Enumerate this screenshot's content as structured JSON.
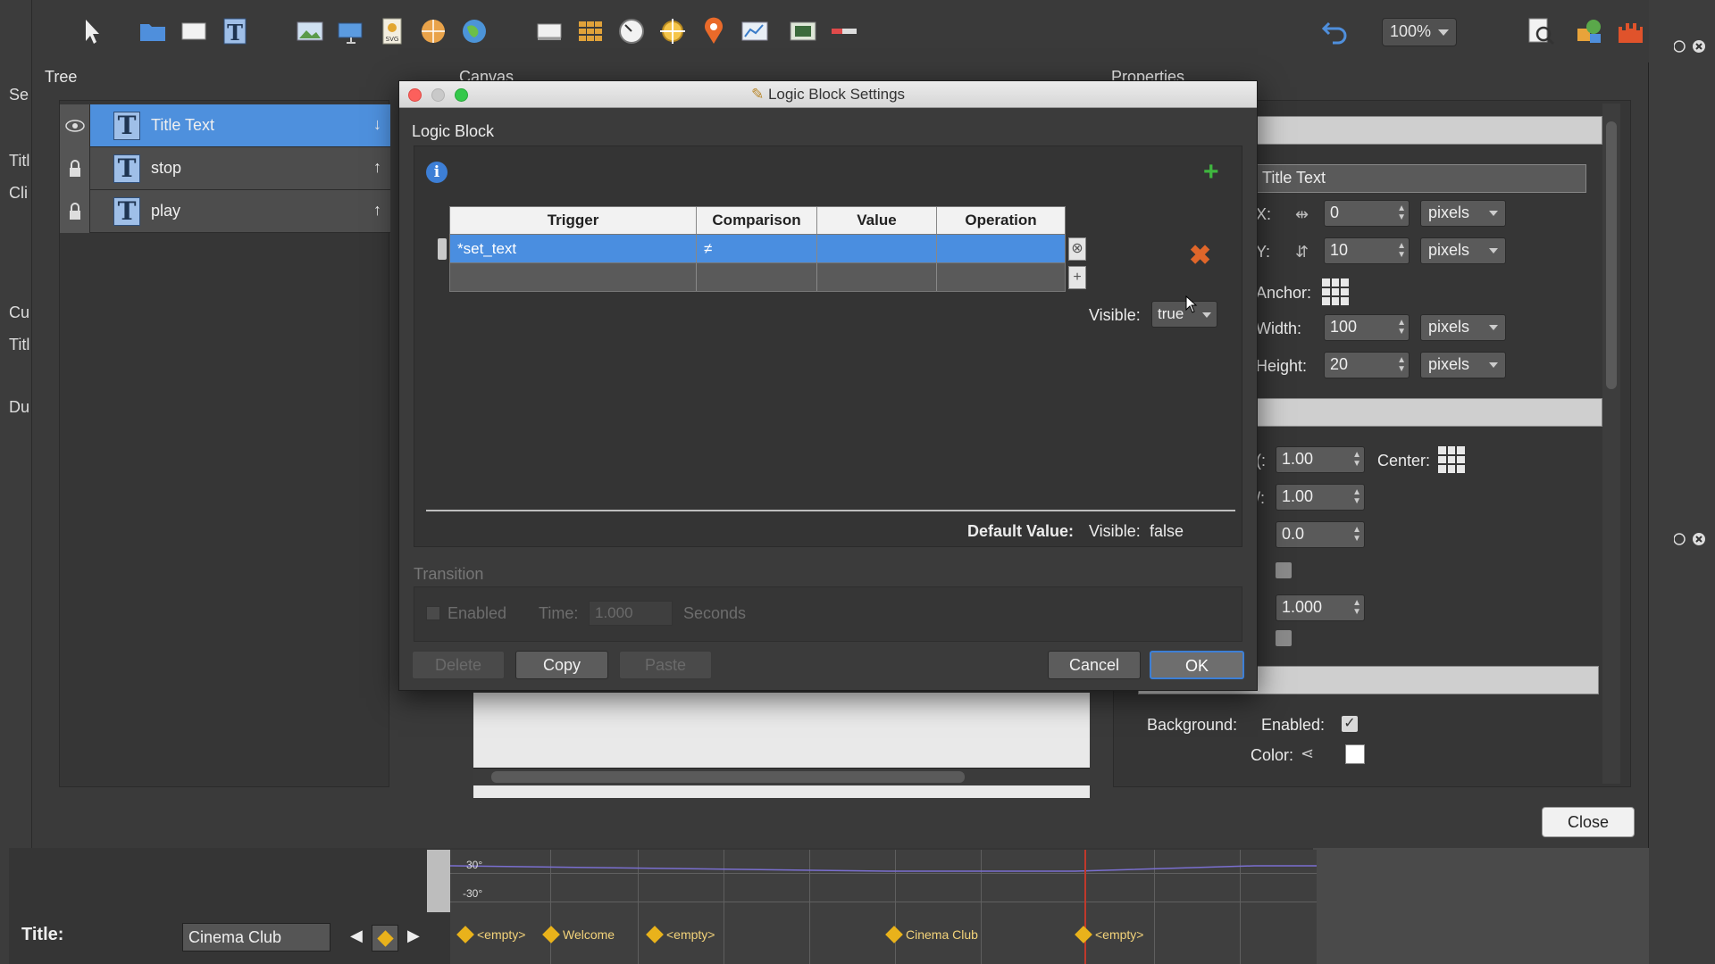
{
  "toolbar": {
    "zoom": "100%",
    "icons": [
      "pointer-icon",
      "folder-icon",
      "rectangle-icon",
      "text-icon",
      "image-icon",
      "slideshow-icon",
      "svg-icon",
      "sphere-icon",
      "globe-icon",
      "screen-icon",
      "grid-icon",
      "gauge-icon",
      "crosshair-icon",
      "map-pin-icon",
      "chart-icon",
      "video-icon",
      "progress-icon",
      "undo-icon",
      "search-icon",
      "shapes-icon",
      "castle-icon"
    ]
  },
  "panels": {
    "tree": "Tree",
    "canvas": "Canvas",
    "properties": "Properties"
  },
  "left_cut_labels": [
    "Se",
    "Titl",
    "Cli",
    "Cu",
    "Titl",
    "Du"
  ],
  "tree": {
    "items": [
      {
        "label": "Title Text",
        "arrow": "↓",
        "lock_icon": "eye-icon",
        "selected": true
      },
      {
        "label": "stop",
        "arrow": "↑",
        "lock_icon": "lock-icon",
        "selected": false
      },
      {
        "label": "play",
        "arrow": "↑",
        "lock_icon": "lock-icon",
        "selected": false
      }
    ]
  },
  "properties": {
    "name_value": "Title Text",
    "x_label": "X:",
    "x_value": "0",
    "x_unit": "pixels",
    "y_label": "Y:",
    "y_value": "10",
    "y_unit": "pixels",
    "anchor_label": "Anchor:",
    "width_label": "Width:",
    "width_value": "100",
    "width_unit": "pixels",
    "height_label": "Height:",
    "height_value": "20",
    "height_unit": "pixels",
    "scale_x_label": "(:",
    "scale_x_value": "1.00",
    "center_label": "Center:",
    "scale_y_label": "/:",
    "scale_y_value": "1.00",
    "rotation_value": "0.0",
    "opacity_value": "1.000",
    "background_label": "Background:",
    "enabled_label": "Enabled:",
    "color_label": "Color:",
    "close_label": "Close"
  },
  "timeline": {
    "title_label": "Title:",
    "title_value": "Cinema Club",
    "deg_top": "30°",
    "deg_bottom": "-30°",
    "keyframes": [
      "<empty>",
      "Welcome",
      "<empty>",
      "Cinema Club",
      "<empty>"
    ]
  },
  "dialog": {
    "title": "Logic Block Settings",
    "section": "Logic Block",
    "columns": [
      "Trigger",
      "Comparison",
      "Value",
      "Operation"
    ],
    "rows": [
      {
        "trigger": "*set_text",
        "comparison": "≠",
        "value": "",
        "operation": ""
      },
      {
        "trigger": "",
        "comparison": "",
        "value": "",
        "operation": ""
      }
    ],
    "visible_label": "Visible:",
    "visible_value": "true",
    "default_value_label": "Default Value:",
    "default_visible_label": "Visible:",
    "default_visible_value": "false",
    "transition_label": "Transition",
    "enabled_label": "Enabled",
    "time_label": "Time:",
    "time_value": "1.000",
    "seconds_label": "Seconds",
    "buttons": {
      "delete": "Delete",
      "copy": "Copy",
      "paste": "Paste",
      "cancel": "Cancel",
      "ok": "OK"
    }
  },
  "colors": {
    "selection": "#4a8ee0",
    "close_red": "#fc605c",
    "minimize_yellow": "#c9c9c9",
    "zoom_green": "#34c84a",
    "add_green": "#3fb63f",
    "delete_orange": "#e0662a",
    "keyframe": "#e9b21b",
    "playhead": "#c0392b"
  }
}
